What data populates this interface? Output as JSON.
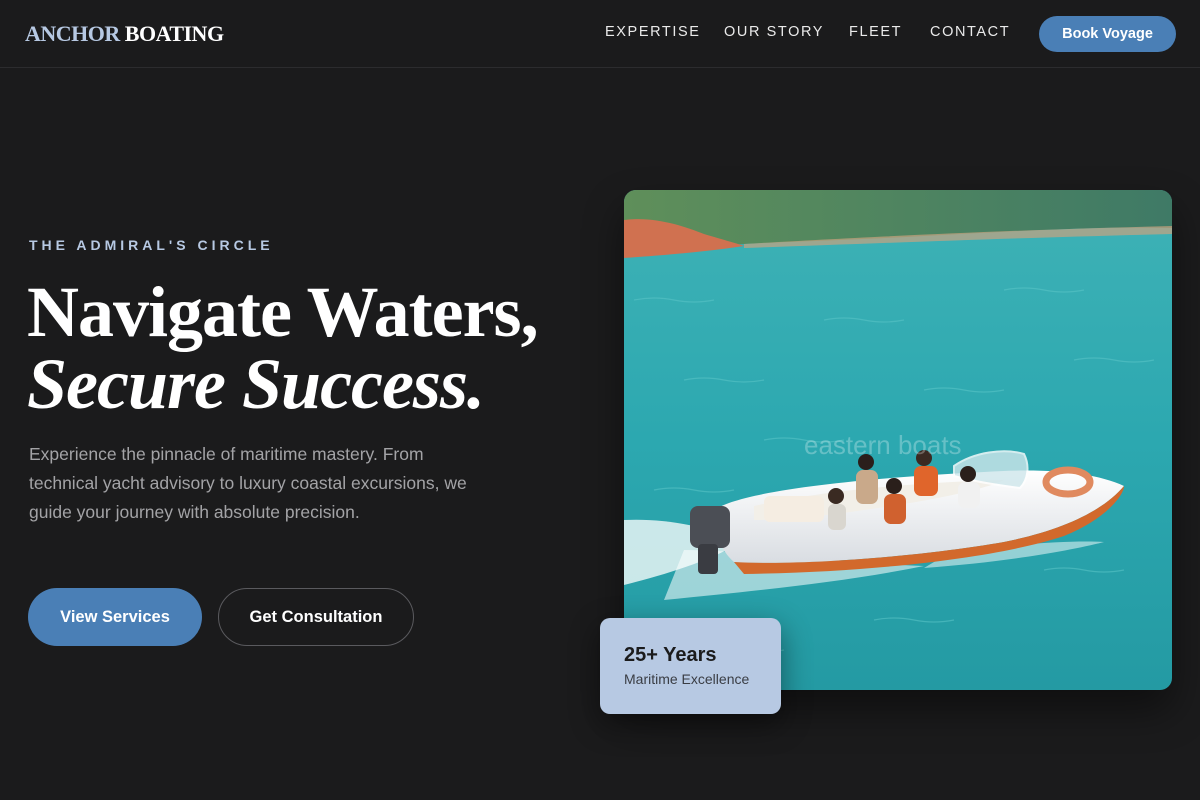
{
  "header": {
    "logo_part1": "ANCHOR",
    "logo_part2": "BOATING",
    "nav": [
      "EXPERTISE",
      "OUR STORY",
      "FLEET",
      "CONTACT"
    ],
    "cta_label": "Book Voyage"
  },
  "hero": {
    "eyebrow": "THE ADMIRAL'S CIRCLE",
    "headline_line1": "Navigate Waters,",
    "headline_line2": "Secure Success.",
    "description": "Experience the pinnacle of maritime mastery. From technical yacht advisory to luxury coastal excursions, we guide your journey with absolute precision.",
    "primary_button": "View Services",
    "secondary_button": "Get Consultation",
    "image_watermark": "eastern boats",
    "badge_title": "25+ Years",
    "badge_subtitle": "Maritime Excellence"
  },
  "colors": {
    "background": "#1b1b1c",
    "accent": "#4a7fb6",
    "accent_light": "#b7c9e3",
    "muted_text": "#a3a3a6"
  }
}
